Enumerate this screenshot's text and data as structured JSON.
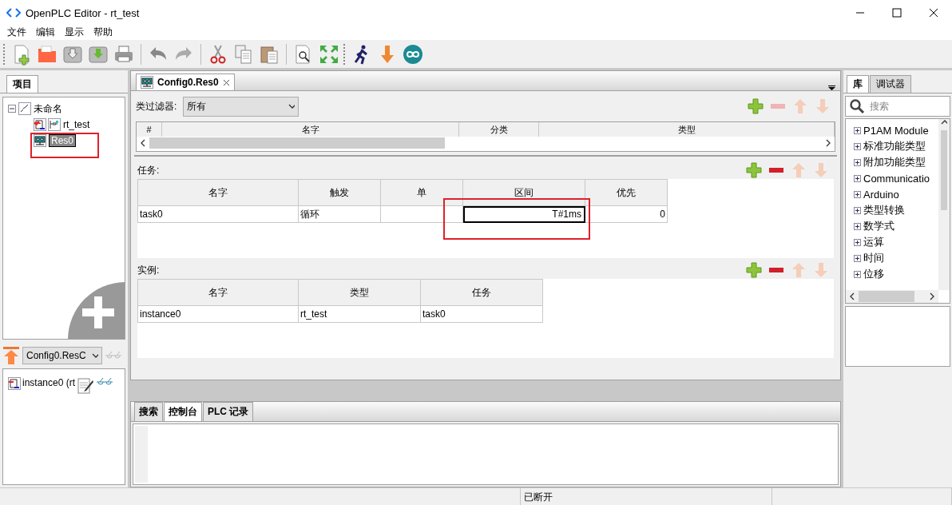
{
  "window": {
    "title": "OpenPLC Editor - rt_test"
  },
  "menu": [
    "文件",
    "编辑",
    "显示",
    "帮助"
  ],
  "project_panel": {
    "tabs": [
      {
        "label": "项目",
        "selected": true
      }
    ],
    "tree": [
      {
        "label": "未命名",
        "kind": "project",
        "expanded": true,
        "selected": false,
        "children": [
          {
            "label": "rt_test",
            "kind": "program",
            "selected": false,
            "annotated": false
          },
          {
            "label": "Res0",
            "kind": "resource",
            "selected": true,
            "annotated": true
          }
        ]
      }
    ],
    "instance_selector": "Config0.ResC",
    "instances": [
      "instance0 (rt"
    ]
  },
  "editor": {
    "tabs": [
      {
        "label": "Config0.Res0",
        "selected": true
      }
    ],
    "filter": {
      "label": "类过滤器:",
      "value": "所有"
    },
    "variables": {
      "buttons": [
        {
          "kind": "add",
          "disabled": false
        },
        {
          "kind": "remove",
          "disabled": true
        },
        {
          "kind": "up",
          "disabled": true
        },
        {
          "kind": "down",
          "disabled": true
        }
      ],
      "columns": [
        "#",
        "名字",
        "分类",
        "类型"
      ]
    },
    "tasks": {
      "label": "任务:",
      "buttons": [
        {
          "kind": "add",
          "disabled": false
        },
        {
          "kind": "remove",
          "disabled": false
        },
        {
          "kind": "up",
          "disabled": true
        },
        {
          "kind": "down",
          "disabled": true
        }
      ],
      "columns": [
        "名字",
        "触发",
        "单",
        "区间",
        "优先"
      ],
      "rows": [
        {
          "name": "task0",
          "trigger": "循环",
          "interval": "T#1ms",
          "priority": "0",
          "annotated": true
        }
      ]
    },
    "instances": {
      "label": "实例:",
      "buttons": [
        {
          "kind": "add",
          "disabled": false
        },
        {
          "kind": "remove",
          "disabled": false
        },
        {
          "kind": "up",
          "disabled": true
        },
        {
          "kind": "down",
          "disabled": true
        }
      ],
      "columns": [
        "名字",
        "类型",
        "任务"
      ],
      "rows": [
        {
          "name": "instance0",
          "type": "rt_test",
          "task": "task0"
        }
      ]
    }
  },
  "library_panel": {
    "tabs": [
      {
        "label": "库",
        "selected": true
      },
      {
        "label": "调试器",
        "selected": false
      }
    ],
    "search": {
      "placeholder": "搜索"
    },
    "items": [
      {
        "label": "P1AM Module",
        "expanded": false
      },
      {
        "label": "标准功能类型",
        "expanded": false
      },
      {
        "label": "附加功能类型",
        "expanded": false
      },
      {
        "label": "Communicatio",
        "expanded": false
      },
      {
        "label": "Arduino",
        "expanded": false
      },
      {
        "label": "类型转换",
        "expanded": false
      },
      {
        "label": "数学式",
        "expanded": false
      },
      {
        "label": "运算",
        "expanded": false
      },
      {
        "label": "时间",
        "expanded": false
      },
      {
        "label": "位移",
        "expanded": false
      }
    ]
  },
  "bottom_panel": {
    "tabs": [
      {
        "label": "搜索",
        "selected": false
      },
      {
        "label": "控制台",
        "selected": true
      },
      {
        "label": "PLC 记录",
        "selected": false
      }
    ]
  },
  "status_bar": {
    "connection": "已断开"
  }
}
